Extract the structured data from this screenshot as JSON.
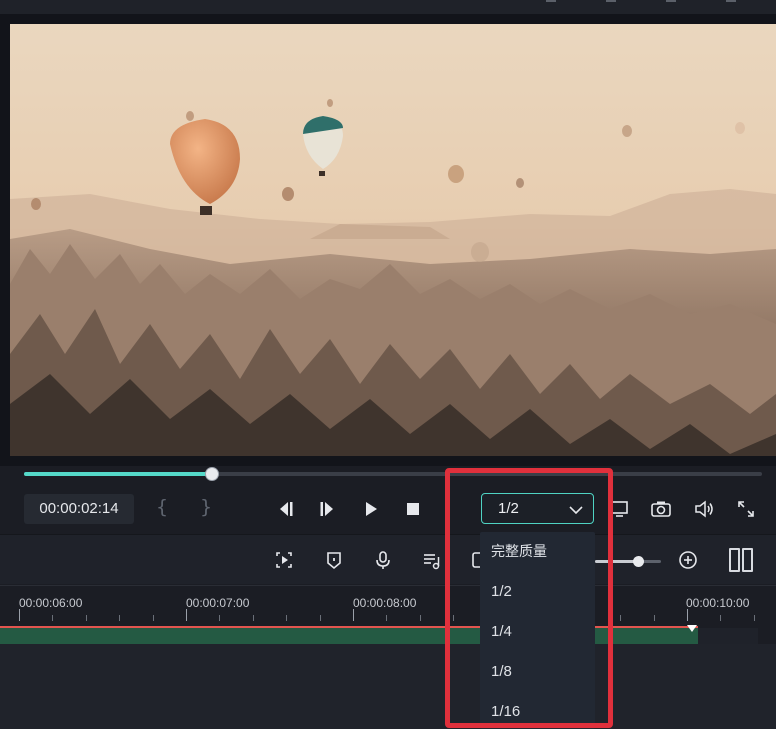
{
  "player": {
    "timecode": "00:00:02:14",
    "mark_in": "{",
    "mark_out": "}",
    "progress": 0.255
  },
  "quality": {
    "selected": "1/2",
    "options": [
      "完整质量",
      "1/2",
      "1/4",
      "1/8",
      "1/16"
    ]
  },
  "zoom": {
    "level": 0.65
  },
  "ruler": {
    "labels": [
      "00:00:06:00",
      "00:00:07:00",
      "00:00:08:00",
      "00:00:10:00"
    ]
  },
  "icons": {
    "topbar": [
      "toolbar-icon",
      "toolbar-icon",
      "toolbar-icon",
      "toolbar-icon"
    ],
    "playback": [
      "step-back-icon",
      "step-forward-icon",
      "play-icon",
      "stop-icon"
    ],
    "preview_right": [
      "monitor-icon",
      "snapshot-camera-icon",
      "volume-icon",
      "fullscreen-icon"
    ],
    "timeline_tools": [
      "render-preview-icon",
      "marker-icon",
      "microphone-icon",
      "audio-mix-icon",
      "add-track-icon",
      "zoom-in-icon",
      "split-view-icon"
    ]
  },
  "colors": {
    "accent": "#55d9c9",
    "highlight_box": "#e0303c",
    "track": "#245a43",
    "playhead": "#e2554f"
  }
}
